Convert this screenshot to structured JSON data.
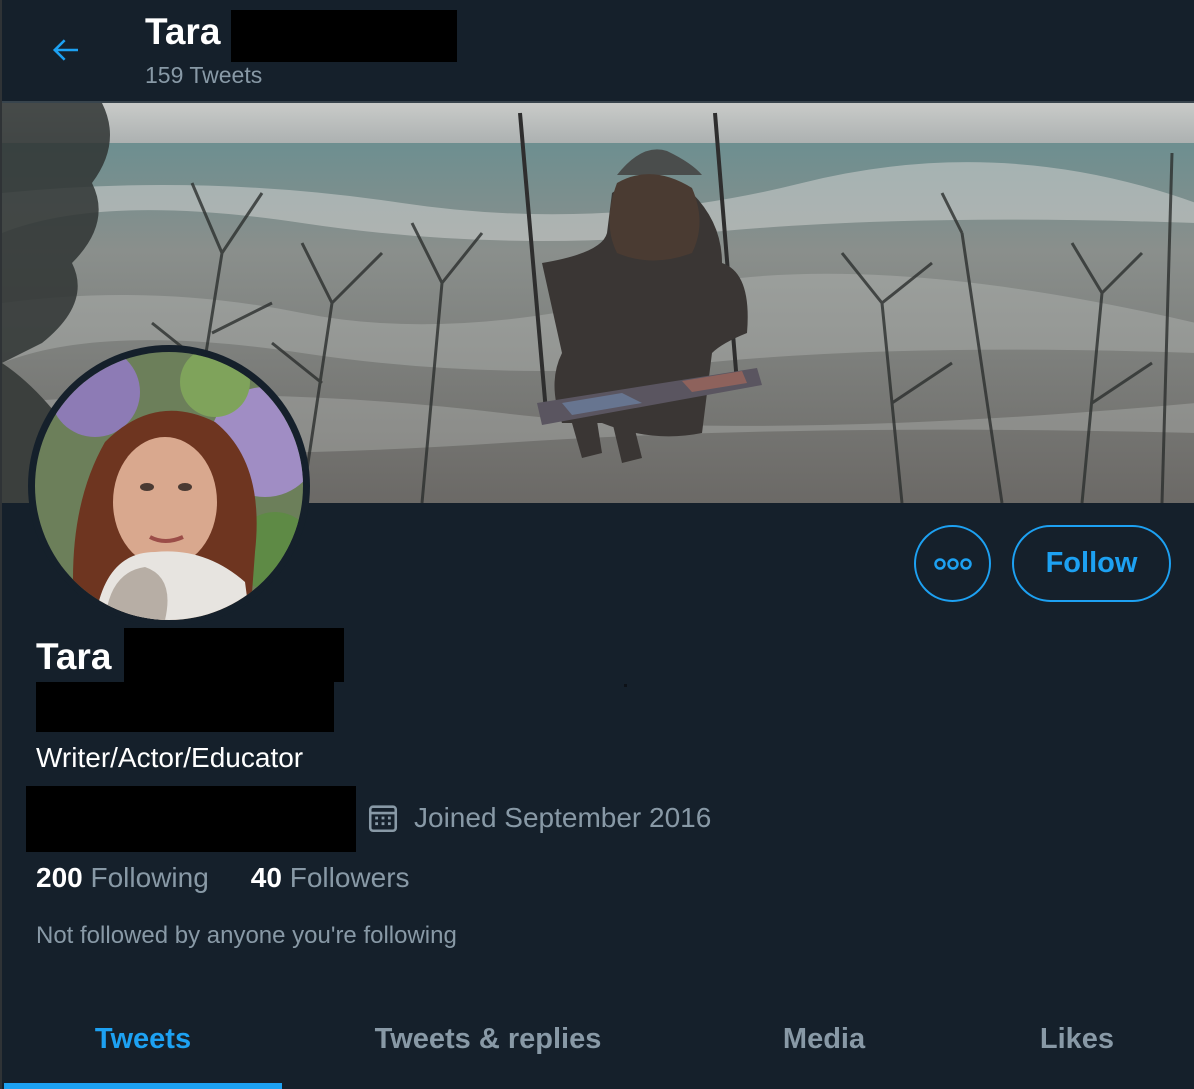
{
  "header": {
    "name": "Tara",
    "tweet_count": "159 Tweets"
  },
  "profile": {
    "display_name": "Tara",
    "bio": "Writer/Actor/Educator",
    "joined": "Joined September 2016",
    "following_count": "200",
    "following_label": "Following",
    "followers_count": "40",
    "followers_label": "Followers",
    "not_followed_note": "Not followed by anyone you're following"
  },
  "actions": {
    "follow_label": "Follow",
    "more_icon": "more-horizontal-icon"
  },
  "tabs": [
    {
      "label": "Tweets",
      "active": true
    },
    {
      "label": "Tweets & replies",
      "active": false
    },
    {
      "label": "Media",
      "active": false
    },
    {
      "label": "Likes",
      "active": false
    }
  ],
  "colors": {
    "background": "#15202b",
    "accent": "#1da1f2",
    "secondary_text": "#8899a6",
    "divider": "#38444d"
  }
}
